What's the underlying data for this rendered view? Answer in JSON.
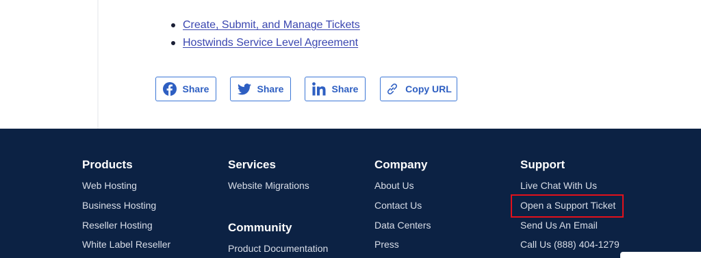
{
  "article": {
    "links": [
      {
        "label": "Create, Submit, and Manage Tickets"
      },
      {
        "label": "Hostwinds Service Level Agreement"
      }
    ]
  },
  "share": {
    "facebook_label": "Share",
    "twitter_label": "Share",
    "linkedin_label": "Share",
    "copy_label": "Copy URL"
  },
  "footer": {
    "products": {
      "title": "Products",
      "items": [
        "Web Hosting",
        "Business Hosting",
        "Reseller Hosting",
        "White Label Reseller"
      ]
    },
    "services": {
      "title": "Services",
      "items": [
        "Website Migrations"
      ]
    },
    "community": {
      "title": "Community",
      "items": [
        "Product Documentation"
      ]
    },
    "company": {
      "title": "Company",
      "items": [
        "About Us",
        "Contact Us",
        "Data Centers",
        "Press"
      ]
    },
    "support": {
      "title": "Support",
      "items": [
        "Live Chat With Us",
        "Open a Support Ticket",
        "Send Us An Email",
        "Call Us (888) 404-1279"
      ]
    }
  },
  "colors": {
    "footer_bg": "#0c2244",
    "link": "#3a46b0",
    "share_accent": "#2e5fc2",
    "highlight": "#e3111b"
  },
  "icons": {
    "facebook": "facebook-icon",
    "twitter": "twitter-icon",
    "linkedin": "linkedin-icon",
    "copy": "link-icon"
  }
}
